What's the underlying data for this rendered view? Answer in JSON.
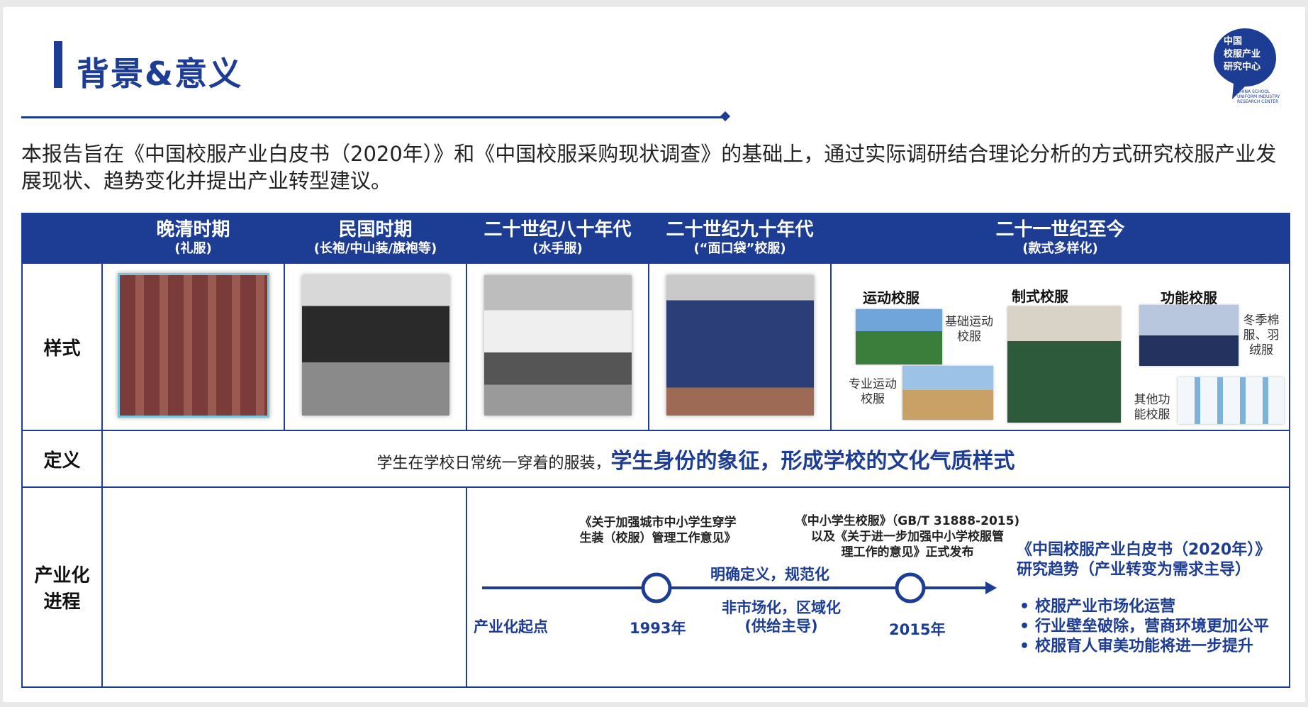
{
  "page_title": "背景&意义",
  "logo": {
    "cn_text": "中国\n校服产业\n研究中心",
    "en_text": "CHINA SCHOOL UNIFORM INDUSTRY RESEARCH CENTER"
  },
  "intro": "本报告旨在《中国校服产业白皮书（2020年）》和《中国校服采购现状调查》的基础上，通过实际调研结合理论分析的方式研究校服产业发展现状、趋势变化并提出产业转型建议。",
  "colors": {
    "brand": "#1c3d93"
  },
  "table": {
    "periods": [
      {
        "title": "晚清时期",
        "sub": "(礼服)"
      },
      {
        "title": "民国时期",
        "sub": "(长袍/中山装/旗袍等)"
      },
      {
        "title": "二十世纪八十年代",
        "sub": "(水手服)"
      },
      {
        "title": "二十世纪九十年代",
        "sub": "(“面口袋”校服)"
      },
      {
        "title": "二十一世纪至今",
        "sub": "(款式多样化)"
      }
    ],
    "row_labels": {
      "style": "样式",
      "definition": "定义",
      "progress": "产业化\n进程"
    },
    "modern_styles": {
      "sport": "运动校服",
      "formal": "制式校服",
      "functional": "功能校服",
      "basic_sport": "基础运动\n校服",
      "pro_sport": "专业运动\n校服",
      "winter": "冬季棉\n服、羽\n绒服",
      "other_func": "其他功\n能校服"
    },
    "definition": {
      "plain": "学生在学校日常统一穿着的服装，",
      "strong": "学生身份的象征，形成学校的文化气质样式"
    }
  },
  "timeline": {
    "start": "产业化起点",
    "year1": "1993年",
    "year2": "2015年",
    "doc1": "《关于加强城市中小学生穿学\n生装（校服）管理工作意见》",
    "doc2": "《中小学生校服》（GB/T 31888-2015)\n以及《关于进一步加强中小学校服管\n理工作的意见》正式发布",
    "above_segment": "明确定义，规范化",
    "below_segment": "非市场化，区域化\n(供给主导)",
    "white_paper": "《中国校服产业白皮书（2020年）》\n研究趋势（产业转变为需求主导）",
    "trends": [
      "校服产业市场化运营",
      "行业壁垒破除，营商环境更加公平",
      "校服育人审美功能将进一步提升"
    ]
  }
}
